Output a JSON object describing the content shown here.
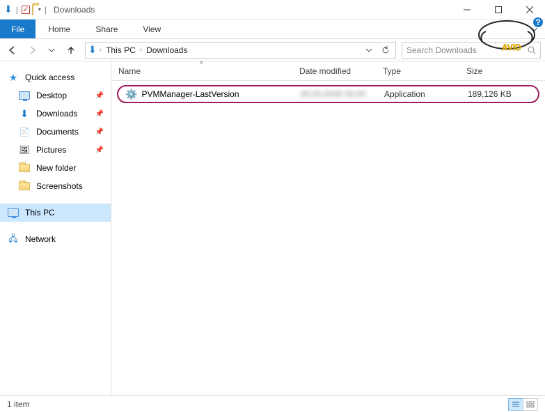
{
  "titlebar": {
    "title": "Downloads"
  },
  "ribbon": {
    "file": "File",
    "tabs": [
      "Home",
      "Share",
      "View"
    ]
  },
  "breadcrumb": {
    "items": [
      "This PC",
      "Downloads"
    ]
  },
  "search": {
    "placeholder": "Search Downloads"
  },
  "sidebar": {
    "quick_access": "Quick access",
    "items": [
      {
        "label": "Desktop",
        "pinned": true
      },
      {
        "label": "Downloads",
        "pinned": true
      },
      {
        "label": "Documents",
        "pinned": true
      },
      {
        "label": "Pictures",
        "pinned": true
      },
      {
        "label": "New folder",
        "pinned": false
      },
      {
        "label": "Screenshots",
        "pinned": false
      }
    ],
    "this_pc": "This PC",
    "network": "Network"
  },
  "columns": {
    "name": "Name",
    "date": "Date modified",
    "type": "Type",
    "size": "Size"
  },
  "files": [
    {
      "name": "PVMManager-LastVersion",
      "date": "",
      "type": "Application",
      "size": "189,126 KB"
    }
  ],
  "status": {
    "count": "1 item"
  }
}
